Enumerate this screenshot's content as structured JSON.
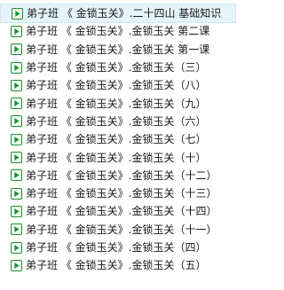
{
  "file_list": {
    "icon": "video-file-icon",
    "accent_color": "#1a8f2e",
    "items": [
      {
        "name": "弟子班 《 金锁玉关》.二十四山 基础知识",
        "selected": true
      },
      {
        "name": "弟子班 《 金锁玉关》.金锁玉关  第二课",
        "selected": false
      },
      {
        "name": "弟子班 《 金锁玉关》.金锁玉关  第一课",
        "selected": false
      },
      {
        "name": "弟子班 《 金锁玉关》.金锁玉关（三）",
        "selected": false
      },
      {
        "name": "弟子班 《 金锁玉关》.金锁玉关（八）",
        "selected": false
      },
      {
        "name": "弟子班 《 金锁玉关》.金锁玉关（九）",
        "selected": false
      },
      {
        "name": "弟子班 《 金锁玉关》.金锁玉关（六）",
        "selected": false
      },
      {
        "name": "弟子班 《 金锁玉关》.金锁玉关（七）",
        "selected": false
      },
      {
        "name": "弟子班 《 金锁玉关》.金锁玉关（十）",
        "selected": false
      },
      {
        "name": "弟子班 《 金锁玉关》.金锁玉关（十二）",
        "selected": false
      },
      {
        "name": "弟子班 《 金锁玉关》.金锁玉关（十三）",
        "selected": false
      },
      {
        "name": "弟子班 《 金锁玉关》.金锁玉关（十四）",
        "selected": false
      },
      {
        "name": "弟子班 《 金锁玉关》.金锁玉关（十一）",
        "selected": false
      },
      {
        "name": "弟子班 《 金锁玉关》.金锁玉关（四）",
        "selected": false
      },
      {
        "name": "弟子班 《 金锁玉关》.金锁玉关（五）",
        "selected": false
      }
    ]
  }
}
